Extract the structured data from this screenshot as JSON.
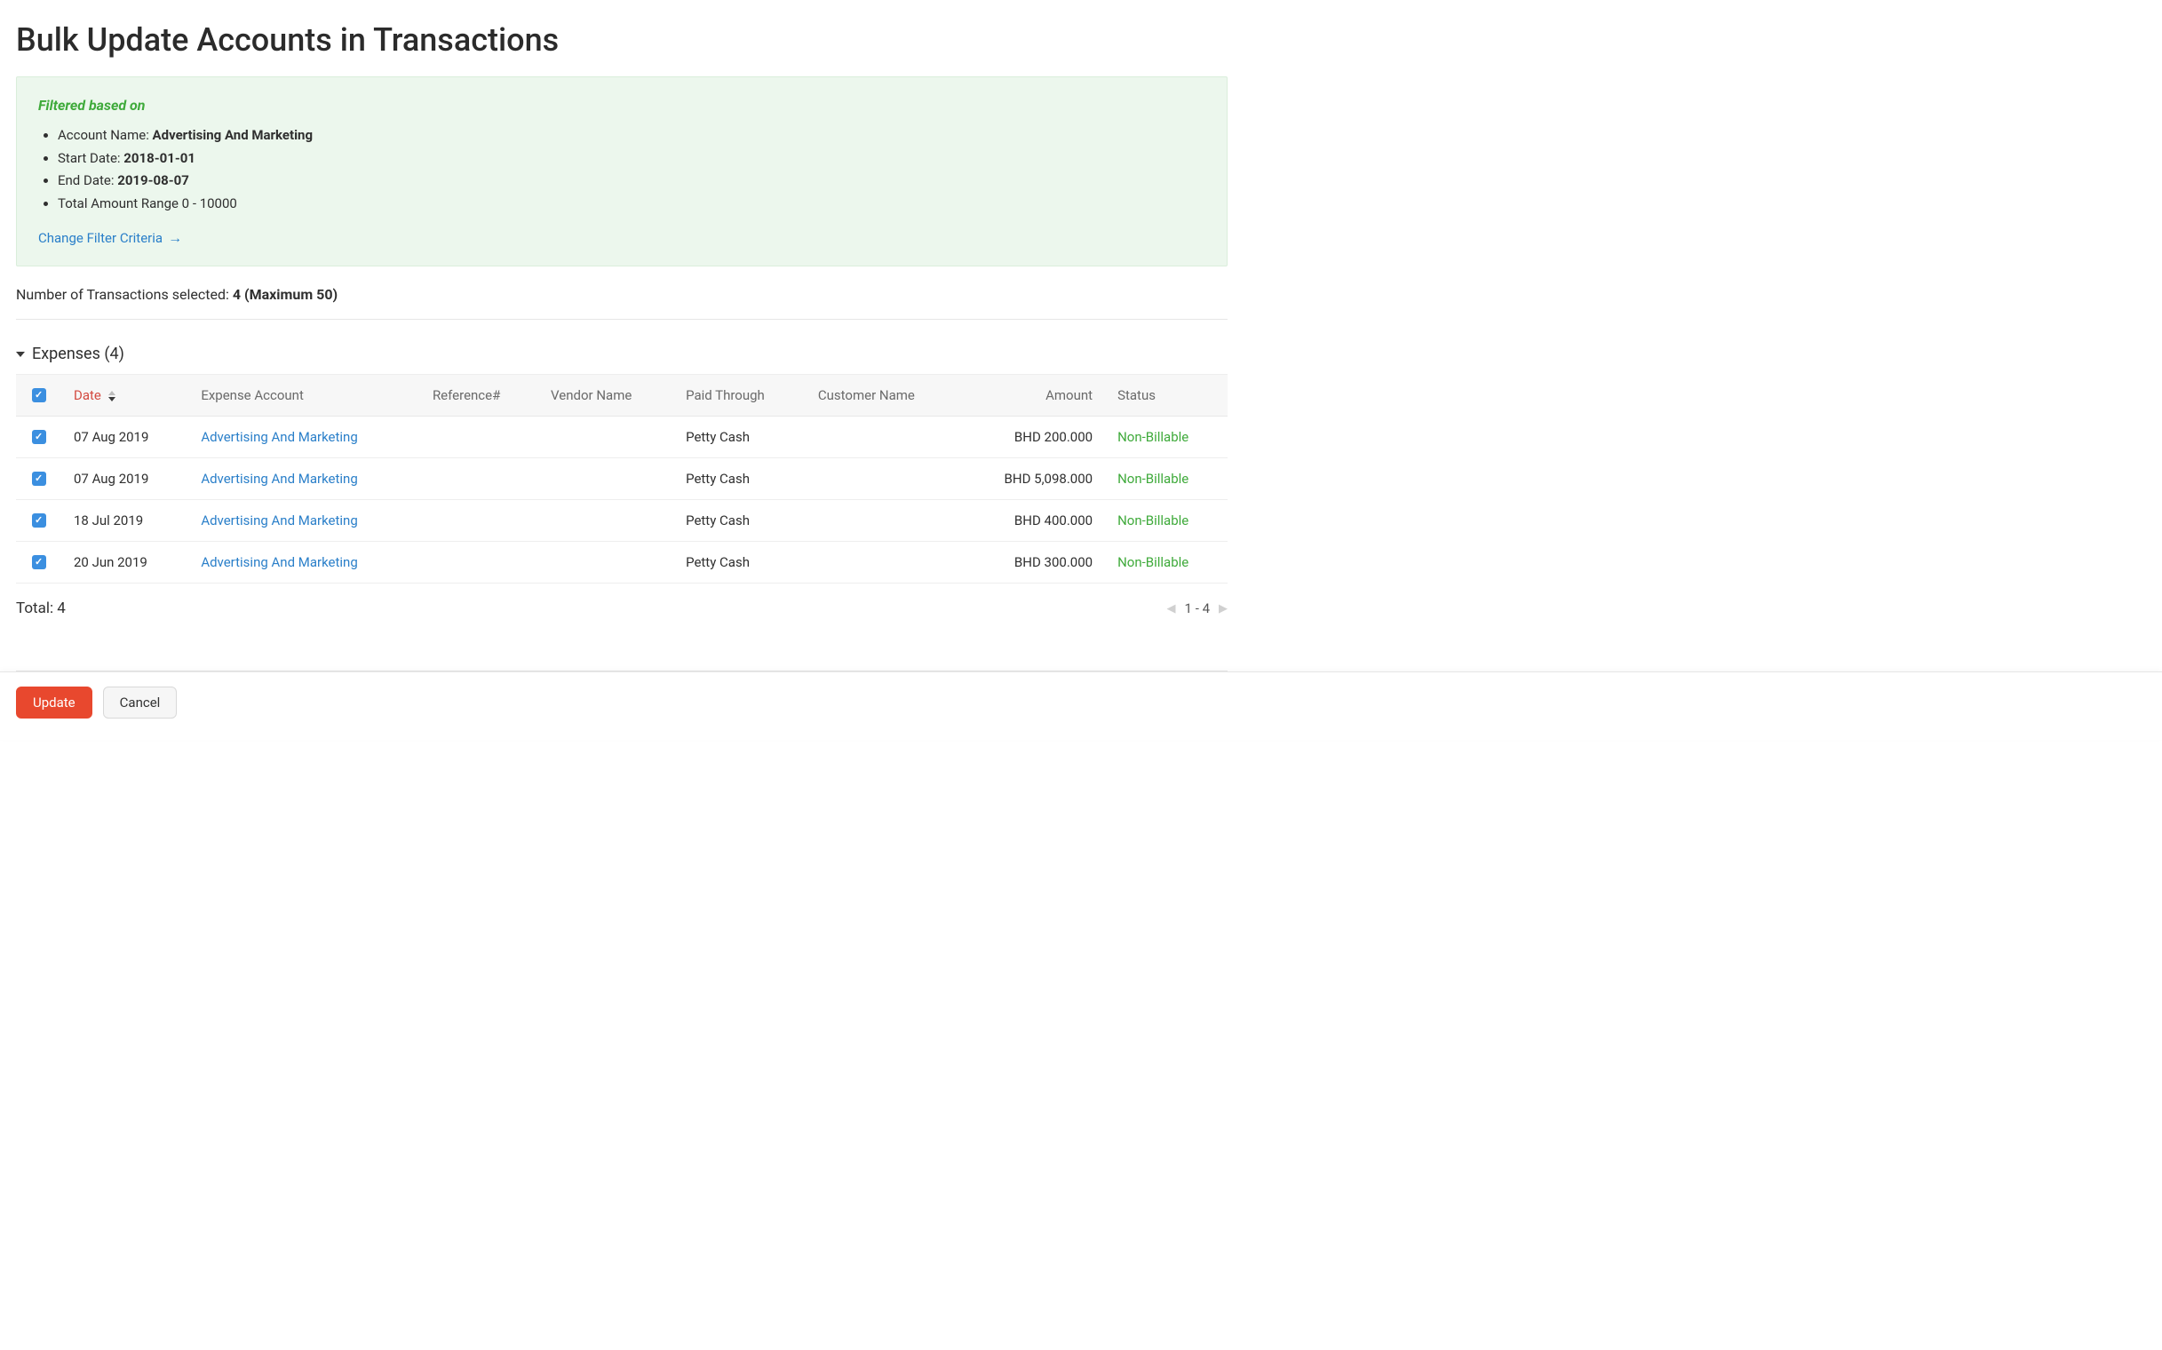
{
  "page": {
    "title": "Bulk Update Accounts in Transactions"
  },
  "filter": {
    "heading": "Filtered based on",
    "items": [
      {
        "label": "Account Name: ",
        "value": "Advertising And Marketing"
      },
      {
        "label": "Start Date: ",
        "value": "2018-01-01"
      },
      {
        "label": "End Date: ",
        "value": "2019-08-07"
      },
      {
        "label": "Total Amount Range 0 - 10000",
        "value": ""
      }
    ],
    "change_link": "Change Filter Criteria"
  },
  "selection": {
    "label": "Number of Transactions selected: ",
    "count_text": "4 (Maximum 50)"
  },
  "section": {
    "title": "Expenses (4)"
  },
  "table": {
    "headers": {
      "date": "Date",
      "expense_account": "Expense Account",
      "reference": "Reference#",
      "vendor_name": "Vendor Name",
      "paid_through": "Paid Through",
      "customer_name": "Customer Name",
      "amount": "Amount",
      "status": "Status"
    },
    "rows": [
      {
        "date": "07 Aug 2019",
        "expense_account": "Advertising And Marketing",
        "reference": "",
        "vendor_name": "",
        "paid_through": "Petty Cash",
        "customer_name": "",
        "amount": "BHD 200.000",
        "status": "Non-Billable"
      },
      {
        "date": "07 Aug 2019",
        "expense_account": "Advertising And Marketing",
        "reference": "",
        "vendor_name": "",
        "paid_through": "Petty Cash",
        "customer_name": "",
        "amount": "BHD 5,098.000",
        "status": "Non-Billable"
      },
      {
        "date": "18 Jul 2019",
        "expense_account": "Advertising And Marketing",
        "reference": "",
        "vendor_name": "",
        "paid_through": "Petty Cash",
        "customer_name": "",
        "amount": "BHD 400.000",
        "status": "Non-Billable"
      },
      {
        "date": "20 Jun 2019",
        "expense_account": "Advertising And Marketing",
        "reference": "",
        "vendor_name": "",
        "paid_through": "Petty Cash",
        "customer_name": "",
        "amount": "BHD 300.000",
        "status": "Non-Billable"
      }
    ]
  },
  "footer": {
    "total_label": "Total: 4",
    "pager_range": "1 - 4"
  },
  "actions": {
    "update": "Update",
    "cancel": "Cancel"
  }
}
